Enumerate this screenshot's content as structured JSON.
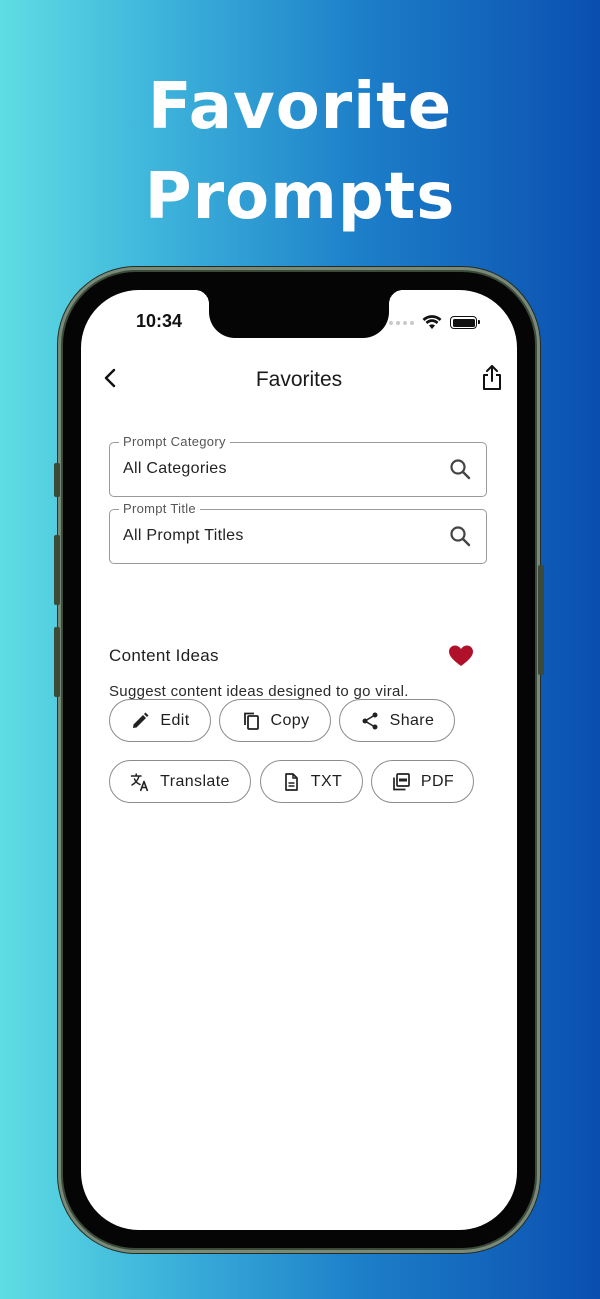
{
  "promo": {
    "headline_line1": "Favorite",
    "headline_line2": "Prompts"
  },
  "status_bar": {
    "time": "10:34",
    "icons": [
      "cellular-dots-icon",
      "wifi-icon",
      "battery-icon"
    ]
  },
  "nav": {
    "title": "Favorites",
    "back_icon": "chevron-left-icon",
    "share_icon": "share-upload-icon"
  },
  "filters": {
    "category": {
      "label": "Prompt Category",
      "value": "All Categories",
      "icon": "search-icon"
    },
    "title": {
      "label": "Prompt Title",
      "value": "All Prompt Titles",
      "icon": "search-icon"
    }
  },
  "prompt_card": {
    "title": "Content Ideas",
    "description": "Suggest content ideas designed to go viral.",
    "favorited": true,
    "favorite_color": "#b0102a",
    "actions": [
      {
        "label": "Edit",
        "icon": "pencil-icon"
      },
      {
        "label": "Copy",
        "icon": "copy-icon"
      },
      {
        "label": "Share",
        "icon": "share-icon"
      },
      {
        "label": "Translate",
        "icon": "translate-icon"
      },
      {
        "label": "TXT",
        "icon": "document-icon"
      },
      {
        "label": "PDF",
        "icon": "pdf-icon"
      }
    ]
  },
  "colors": {
    "background_gradient_start": "#5fdde3",
    "background_gradient_end": "#0a4fb0",
    "phone_frame": "#3c4a3a"
  }
}
